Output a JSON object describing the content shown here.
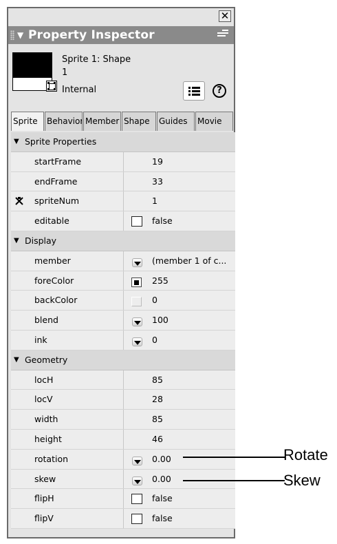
{
  "window": {
    "close_symbol": "✕"
  },
  "titlebar": {
    "title": "Property Inspector",
    "options_icon": "options-menu-icon"
  },
  "sprite": {
    "name": "Sprite 1: Shape",
    "number": "1",
    "type": "Internal"
  },
  "tabs": [
    {
      "label": "Sprite",
      "active": true
    },
    {
      "label": "Behaviors"
    },
    {
      "label": "Member"
    },
    {
      "label": "Shape"
    },
    {
      "label": "Guides"
    },
    {
      "label": "Movie"
    }
  ],
  "sections": {
    "sprite": {
      "label": "Sprite Properties",
      "rows": [
        {
          "name": "startFrame",
          "value": "19"
        },
        {
          "name": "endFrame",
          "value": "33"
        },
        {
          "name": "spriteNum",
          "value": "1"
        },
        {
          "name": "editable",
          "value": "false"
        }
      ]
    },
    "display": {
      "label": "Display",
      "rows": [
        {
          "name": "member",
          "value": "(member 1 of c..."
        },
        {
          "name": "foreColor",
          "value": "255"
        },
        {
          "name": "backColor",
          "value": "0"
        },
        {
          "name": "blend",
          "value": "100"
        },
        {
          "name": "ink",
          "value": "0"
        }
      ]
    },
    "geometry": {
      "label": "Geometry",
      "rows": [
        {
          "name": "locH",
          "value": "85"
        },
        {
          "name": "locV",
          "value": "28"
        },
        {
          "name": "width",
          "value": "85"
        },
        {
          "name": "height",
          "value": "46"
        },
        {
          "name": "rotation",
          "value": "0.00"
        },
        {
          "name": "skew",
          "value": "0.00"
        },
        {
          "name": "flipH",
          "value": "false"
        },
        {
          "name": "flipV",
          "value": "false"
        }
      ]
    }
  },
  "callouts": {
    "rotate": "Rotate",
    "skew": "Skew"
  }
}
